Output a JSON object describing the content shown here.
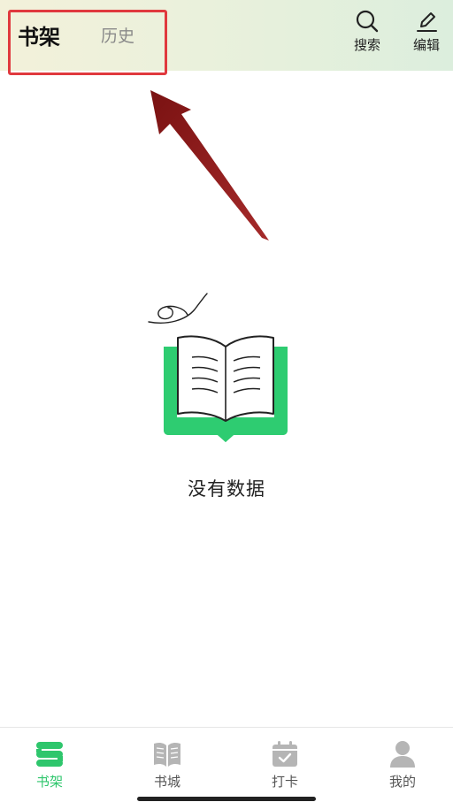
{
  "header": {
    "tab_bookshelf": "书架",
    "tab_history": "历史",
    "search_label": "搜索",
    "edit_label": "编辑",
    "highlight_color": "#e0393e"
  },
  "annotation": {
    "arrow_color": "#8b1a1a"
  },
  "empty_state": {
    "text": "没有数据",
    "accent_color": "#2ecc71"
  },
  "bottom_nav": {
    "items": [
      {
        "label": "书架",
        "icon": "bookshelf-icon",
        "active": true
      },
      {
        "label": "书城",
        "icon": "book-store-icon",
        "active": false
      },
      {
        "label": "打卡",
        "icon": "calendar-check-icon",
        "active": false
      },
      {
        "label": "我的",
        "icon": "profile-icon",
        "active": false
      }
    ],
    "active_color": "#2ec66c",
    "inactive_color": "#aaaaaa"
  }
}
